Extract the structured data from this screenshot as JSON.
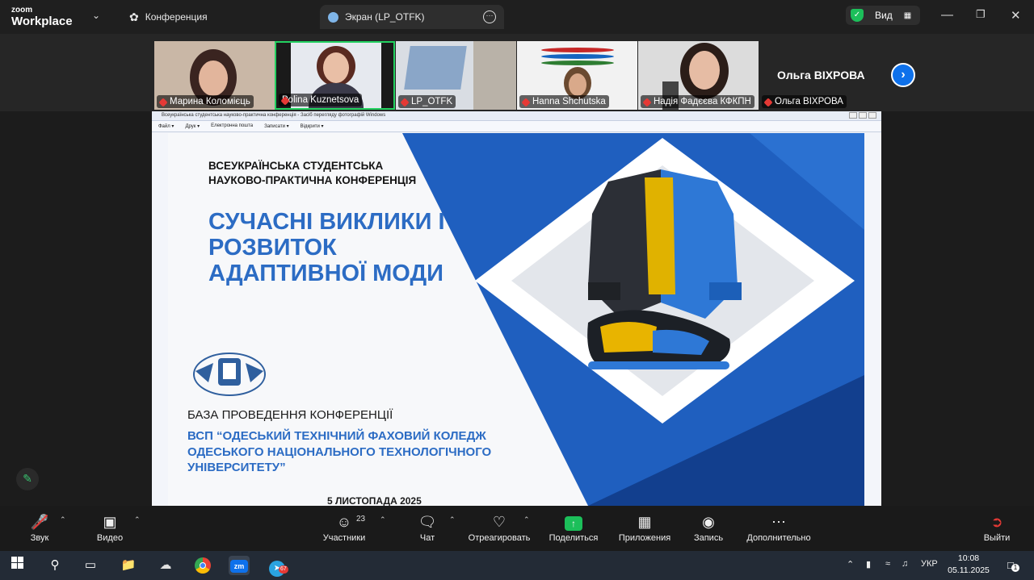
{
  "app": {
    "brand_top": "zoom",
    "brand_main": "Workplace"
  },
  "tabs": [
    {
      "label": "Конференция",
      "icon": "paw-icon"
    },
    {
      "label": "Экран (LP_OTFK)",
      "icon": "screen-share-icon"
    }
  ],
  "view_button": {
    "label": "Вид"
  },
  "participants_strip": {
    "tiles": [
      {
        "name": "Марина Коломієць"
      },
      {
        "name": "Polina Kuznetsova",
        "active_speaker": true
      },
      {
        "name": "LP_OTFK"
      },
      {
        "name": "Hanna Shchutska"
      },
      {
        "name": "Надія Фадєєва КФКПН"
      },
      {
        "name": "Ольга ВІХРОВА"
      }
    ],
    "large_name": "Ольга ВІХРОВА"
  },
  "shared_window": {
    "title": "Всеукраїнська студентська науково-практична конференція - Засіб перегляду фотографій Windows",
    "menu": [
      "Файл ▾",
      "Друк ▾",
      "Електронна пошта",
      "Записати ▾",
      "Відкрити ▾"
    ]
  },
  "slide": {
    "header_line1": "ВСЕУКРАЇНСЬКА СТУДЕНТСЬКА",
    "header_line2": "НАУКОВО-ПРАКТИЧНА КОНФЕРЕНЦІЯ",
    "title_line1": "СУЧАСНІ ВИКЛИКИ І",
    "title_line2": "РОЗВИТОК",
    "title_line3": "АДАПТИВНОЇ МОДИ",
    "base_label": "БАЗА ПРОВЕДЕННЯ КОНФЕРЕНЦІЇ",
    "college_line1": "ВСП “ОДЕСЬКИЙ ТЕХНІЧНИЙ ФАХОВИЙ КОЛЕДЖ",
    "college_line2": "ОДЕСЬКОГО НАЦІОНАЛЬНОГО ТЕХНОЛОГІЧНОГО",
    "college_line3": "УНІВЕРСИТЕТУ”",
    "date": "5 ЛИСТОПАДА 2025"
  },
  "toolbar": {
    "audio": "Звук",
    "video": "Видео",
    "participants": "Участники",
    "participants_count": "23",
    "chat": "Чат",
    "react": "Отреагировать",
    "share": "Поделиться",
    "apps": "Приложения",
    "record": "Запись",
    "more": "Дополнительно",
    "leave": "Выйти"
  },
  "taskbar": {
    "lang": "УКР",
    "time": "10:08",
    "date": "05.11.2025",
    "telegram_badge": "67",
    "notif_count": "1"
  }
}
